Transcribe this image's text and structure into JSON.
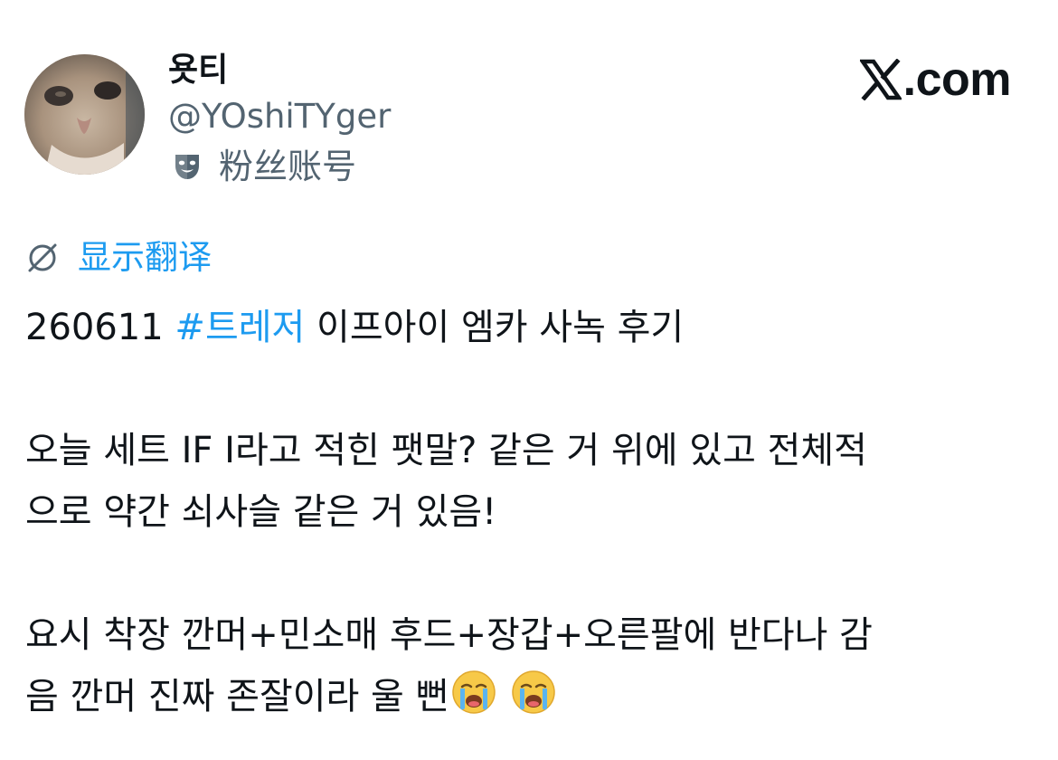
{
  "author": {
    "display_name": "욧티",
    "handle": "@YOshiTYger",
    "account_label": "粉丝账号",
    "avatar_icon": "cat-photo-avatar",
    "label_icon": "theater-mask-icon"
  },
  "brand": {
    "text": ".com",
    "logo_icon": "x-logo-icon"
  },
  "translate": {
    "label": "显示翻译",
    "icon": "globe-translate-icon"
  },
  "tweet": {
    "line1_prefix": "260611 ",
    "hashtag": "#트레저",
    "line1_suffix": " 이프아이 엠카 사녹 후기",
    "para2_line1": "오늘 세트 IF I라고 적힌 팻말? 같은 거 위에 있고 전체적",
    "para2_line2": "으로 약간 쇠사슬 같은 거 있음!",
    "para3_line1": "요시 착장 깐머+민소매 후드+장갑+오른팔에 반다나 감",
    "para3_line2": "음 깐머 진짜 존잘이라 울 뻔",
    "emojis": [
      "loudly-crying-face-emoji",
      "loudly-crying-face-emoji"
    ]
  },
  "colors": {
    "text": "#0f1419",
    "secondary": "#536471",
    "link": "#1d9bf0",
    "background": "#ffffff"
  }
}
